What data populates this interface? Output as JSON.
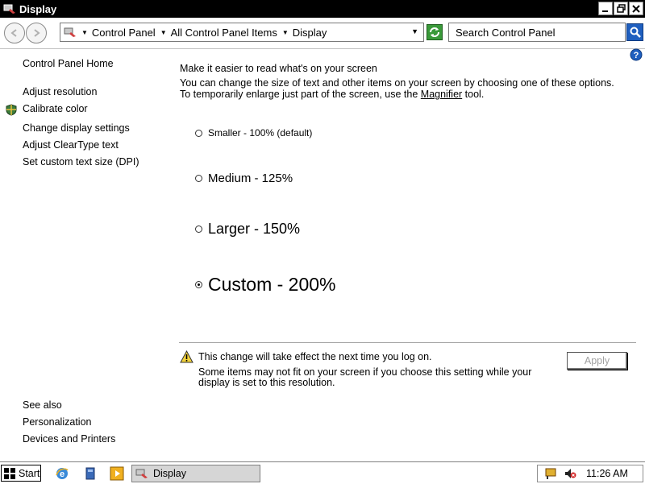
{
  "window": {
    "title": "Display",
    "app_icon": "display-control-panel-icon",
    "controls": [
      "minimize-icon",
      "restore-icon",
      "close-icon"
    ]
  },
  "address_bar": {
    "breadcrumbs": [
      "Control Panel",
      "All Control Panel Items",
      "Display"
    ],
    "search_placeholder": "Search Control Panel"
  },
  "left_pane": {
    "home": "Control Panel Home",
    "links": [
      "Adjust resolution",
      "Calibrate color",
      "Change display settings",
      "Adjust ClearType text",
      "Set custom text size (DPI)"
    ],
    "see_also_heading": "See also",
    "see_also": [
      "Personalization",
      "Devices and Printers"
    ]
  },
  "main": {
    "heading": "Make it easier to read what's on your screen",
    "description_line1": "You can change the size of text and other items on your screen by choosing one of these options.",
    "description_line2_pre": "To temporarily enlarge just part of the screen, use the ",
    "magnifier_link": "Magnifier",
    "description_line2_post": " tool.",
    "options": [
      {
        "label": "Smaller - 100% (default)",
        "checked": false
      },
      {
        "label": "Medium - 125%",
        "checked": false
      },
      {
        "label": "Larger - 150%",
        "checked": false
      },
      {
        "label": "Custom - 200%",
        "checked": true
      }
    ],
    "warning_title": "This change will take effect the next time you log on.",
    "warning_line1": "Some items may not fit on your screen if you choose this setting while your",
    "warning_line2": "display is set to this resolution.",
    "apply_label": "Apply"
  },
  "taskbar": {
    "start_label": "Start",
    "task_label": "Display",
    "clock": "11:26 AM"
  },
  "colors": {
    "titlebar": "#000000",
    "taskbar_item_active": "#d6d6d6",
    "search_button": "#1f5fbf"
  }
}
